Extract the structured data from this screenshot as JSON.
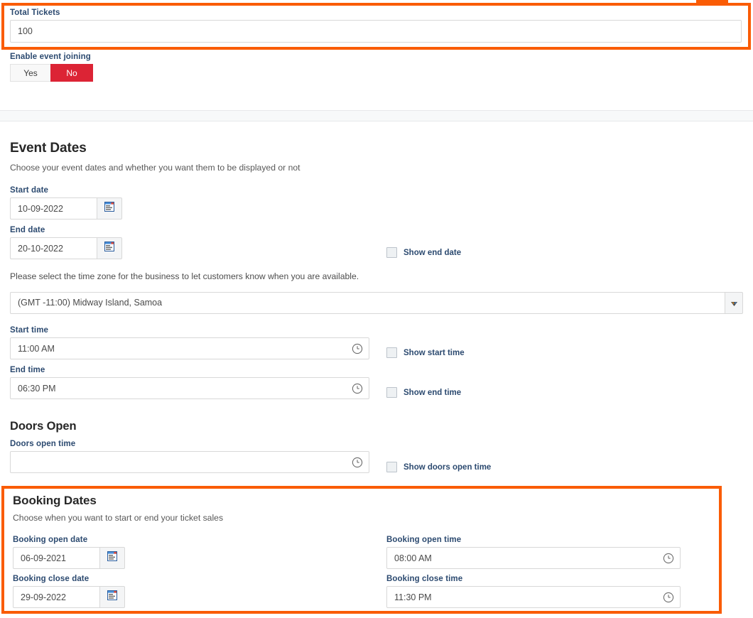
{
  "tickets": {
    "label": "Total Tickets",
    "value": "100",
    "placeholder": ""
  },
  "event_joining": {
    "label": "Enable event joining",
    "options": [
      "Yes",
      "No"
    ],
    "selected": "No"
  },
  "event_dates": {
    "title": "Event Dates",
    "subtitle": "Choose your event dates and whether you want them to be displayed or not",
    "start_date": {
      "label": "Start date",
      "value": "10-09-2022",
      "icon": "calendar-icon"
    },
    "end_date": {
      "label": "End date",
      "value": "20-10-2022",
      "icon": "calendar-icon"
    },
    "show_end_date": {
      "label": "Show end date",
      "checked": false
    },
    "timezone_help": "Please select the time zone for the business to let customers know when you are available.",
    "timezone": {
      "value": "(GMT -11:00) Midway Island, Samoa",
      "icon": "chevron-down-icon"
    },
    "start_time": {
      "label": "Start time",
      "value": "11:00 AM",
      "icon": "clock-icon"
    },
    "show_start_time": {
      "label": "Show start time",
      "checked": false
    },
    "end_time": {
      "label": "End time",
      "value": "06:30 PM",
      "icon": "clock-icon"
    },
    "show_end_time": {
      "label": "Show end time",
      "checked": false
    }
  },
  "doors_open": {
    "title": "Doors Open",
    "time": {
      "label": "Doors open time",
      "value": "",
      "placeholder": "",
      "icon": "clock-icon"
    },
    "show_doors_open_time": {
      "label": "Show doors open time",
      "checked": false
    }
  },
  "booking_dates": {
    "title": "Booking Dates",
    "subtitle": "Choose when you want to start or end your ticket sales",
    "open_date": {
      "label": "Booking open date",
      "value": "06-09-2021",
      "icon": "calendar-icon"
    },
    "close_date": {
      "label": "Booking close date",
      "value": "29-09-2022",
      "icon": "calendar-icon"
    },
    "open_time": {
      "label": "Booking open time",
      "value": "08:00 AM",
      "icon": "clock-icon"
    },
    "close_time": {
      "label": "Booking close time",
      "value": "11:30 PM",
      "icon": "clock-icon"
    }
  },
  "colors": {
    "highlight": "#fa5c05",
    "toggle_on": "#dc2435",
    "label": "#2c4a70"
  }
}
